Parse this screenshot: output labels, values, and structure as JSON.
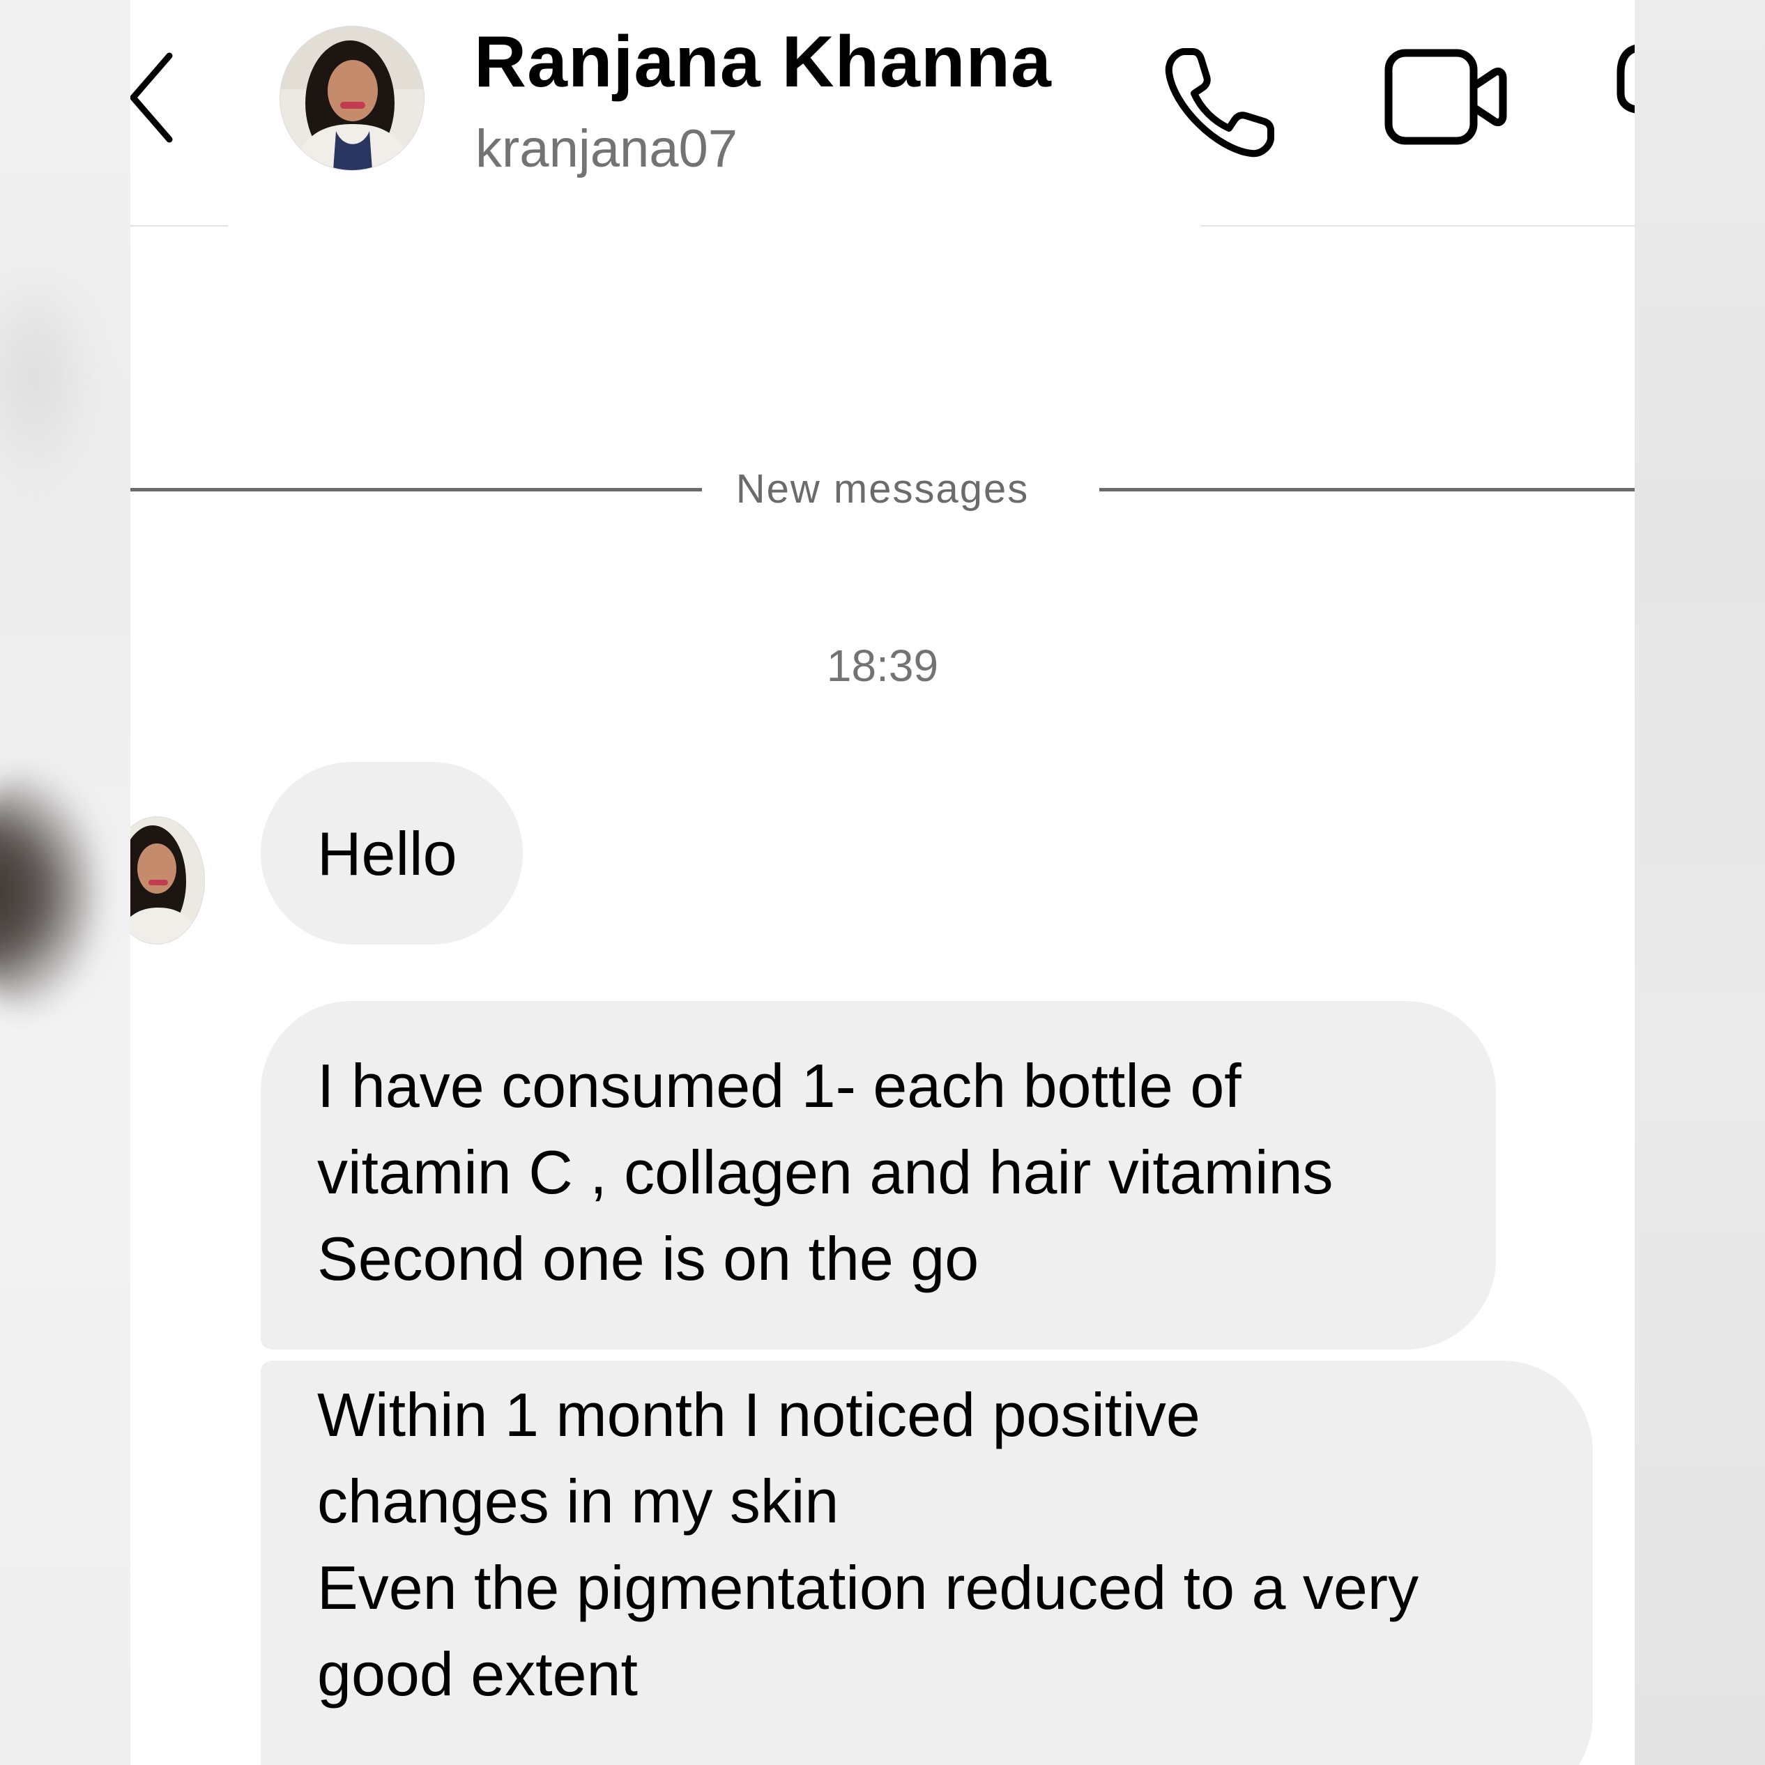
{
  "contact": {
    "name": "Ranjana Khanna",
    "username": "kranjana07"
  },
  "header": {
    "back_icon": "chevron-left-icon",
    "call_icon": "phone-icon",
    "video_icon": "video-camera-icon",
    "info_icon": "info-icon"
  },
  "thread": {
    "divider_label": "New messages",
    "timestamp": "18:39",
    "messages": [
      {
        "lines": [
          "Hello"
        ]
      },
      {
        "lines": [
          "I have consumed 1- each bottle of",
          "vitamin C , collagen and hair vitamins",
          "Second one is on the go"
        ]
      },
      {
        "lines": [
          "Within 1 month I noticed positive",
          "changes in my skin",
          "Even the pigmentation reduced to a very",
          "good extent"
        ]
      }
    ]
  },
  "colors": {
    "bubble_bg": "#efefef",
    "secondary_text": "#737373",
    "divider": "#6b6b6b",
    "panel_bg": "#ffffff"
  }
}
